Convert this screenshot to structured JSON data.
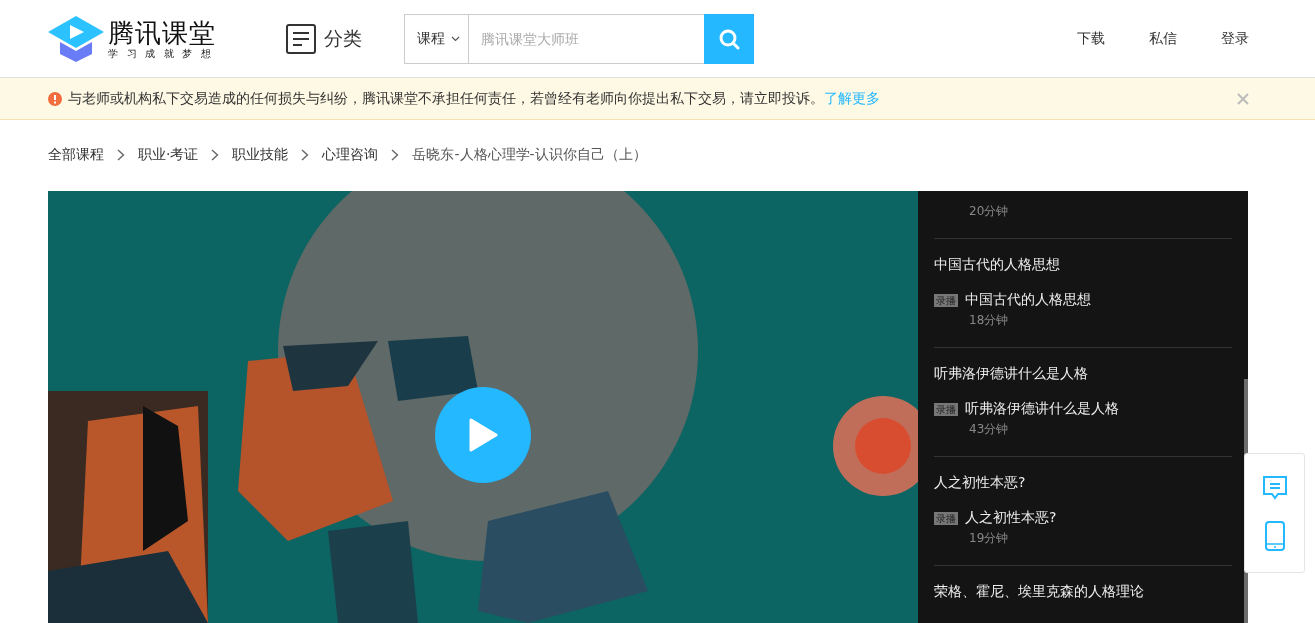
{
  "header": {
    "logo": {
      "title": "腾讯课堂",
      "slogan": "学习成就梦想"
    },
    "category": {
      "label": "分类"
    },
    "search": {
      "scope": "课程",
      "placeholder": "腾讯课堂大师班"
    },
    "nav": [
      "下载",
      "私信",
      "登录"
    ]
  },
  "notice": {
    "text": "与老师或机构私下交易造成的任何损失与纠纷，腾讯课堂不承担任何责任，若曾经有老师向你提出私下交易，请立即投诉。",
    "link": "了解更多"
  },
  "breadcrumb": [
    "全部课程",
    "职业·考证",
    "职业技能",
    "心理咨询",
    "岳晓东-人格心理学-认识你自己（上）"
  ],
  "playlist": [
    {
      "kind": "duration",
      "duration": "20分钟"
    },
    {
      "kind": "chapter",
      "title": "中国古代的人格思想"
    },
    {
      "kind": "lesson",
      "tag": "录播",
      "title": "中国古代的人格思想",
      "duration": "18分钟"
    },
    {
      "kind": "chapter",
      "title": "听弗洛伊德讲什么是人格"
    },
    {
      "kind": "lesson",
      "tag": "录播",
      "title": "听弗洛伊德讲什么是人格",
      "duration": "43分钟"
    },
    {
      "kind": "chapter",
      "title": "人之初性本恶?"
    },
    {
      "kind": "lesson",
      "tag": "录播",
      "title": "人之初性本恶?",
      "duration": "19分钟"
    },
    {
      "kind": "chapter",
      "title": "荣格、霍尼、埃里克森的人格理论"
    }
  ]
}
